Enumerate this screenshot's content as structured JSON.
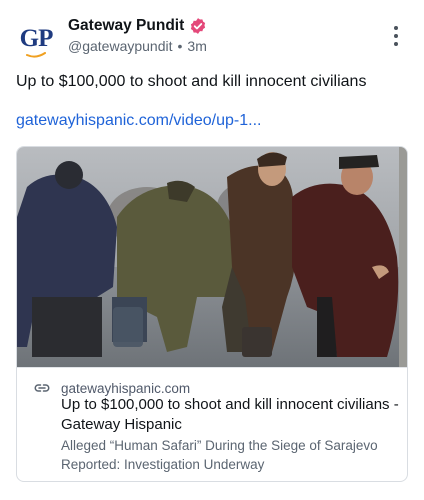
{
  "author": {
    "display_name": "Gateway Pundit",
    "handle": "@gatewaypundit",
    "separator": "•",
    "timestamp": "3m",
    "avatar_text": "GP",
    "verified_color": "#e4487a"
  },
  "post": {
    "text": "Up to $100,000 to shoot and kill innocent civilians",
    "link_text": "gatewayhispanic.com/video/up-1..."
  },
  "card": {
    "domain": "gatewayhispanic.com",
    "title": "Up to $100,000 to shoot and kill innocent civilians - Gateway Hispanic",
    "description": "Alleged “Human Safari” During the Siege of Sarajevo Reported: Investigation Underway"
  },
  "icons": {
    "menu": "more-vertical-icon",
    "verified": "verified-badge-icon",
    "link": "link-icon"
  },
  "colors": {
    "link": "#1f63d8",
    "avatar_blue": "#1f3b80",
    "avatar_orange": "#f0a020"
  }
}
